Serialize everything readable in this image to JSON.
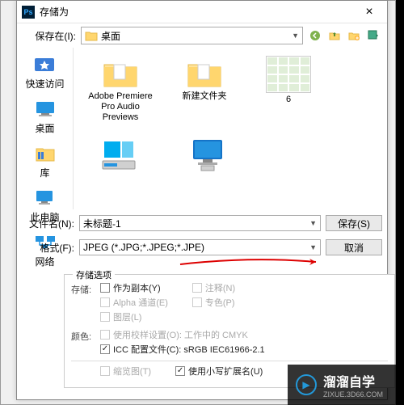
{
  "titlebar": {
    "title": "存储为"
  },
  "save_in": {
    "label": "保存在(I):",
    "value": "桌面"
  },
  "places": {
    "quick": "快速访问",
    "desktop": "桌面",
    "library": "库",
    "this_pc": "此电脑",
    "network": "网络"
  },
  "files": {
    "item1": "Adobe Premiere Pro Audio Previews",
    "item2": "新建文件夹",
    "item3": "6"
  },
  "filename": {
    "label": "文件名(N):",
    "value": "未标题-1"
  },
  "format": {
    "label": "格式(F):",
    "value": "JPEG (*.JPG;*.JPEG;*.JPE)"
  },
  "buttons": {
    "save": "保存(S)",
    "cancel": "取消"
  },
  "save_options": {
    "section": "存储选项",
    "store_lbl": "存储:",
    "as_copy": "作为副本(Y)",
    "annotations": "注释(N)",
    "alpha": "Alpha 通道(E)",
    "spot": "专色(P)",
    "layers": "图层(L)",
    "color_lbl": "颜色:",
    "proof": "使用校样设置(O): 工作中的 CMYK",
    "icc": "ICC 配置文件(C): sRGB IEC61966-2.1",
    "thumbnail": "缩览图(T)",
    "lower_ext": "使用小写扩展名(U)"
  },
  "watermark": {
    "brand": "溜溜自学",
    "url": "ZIXUE.3D66.COM"
  }
}
